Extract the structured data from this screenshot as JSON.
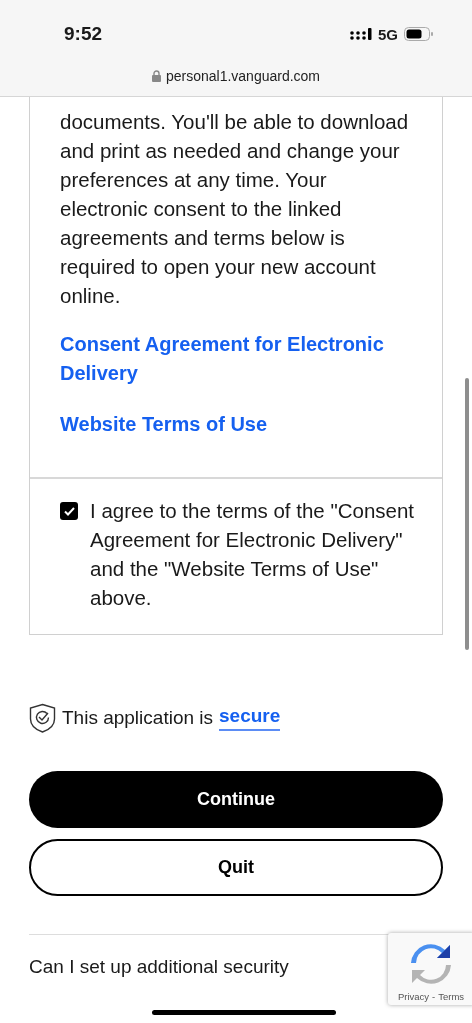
{
  "status_bar": {
    "time": "9:52",
    "network": "5G"
  },
  "address_bar": {
    "url": "personal1.vanguard.com"
  },
  "consent_card": {
    "paragraph": "documents. You'll be able to download and print as needed and change your preferences at any time. Your electronic consent to the linked agreements and terms below is required to open your new account online.",
    "links": [
      "Consent Agreement for Electronic Delivery",
      "Website Terms of Use"
    ],
    "agreement": {
      "checked": true,
      "label": "I agree to the terms of the \"Consent Agreement for Electronic Delivery\" and the \"Website Terms of Use\" above."
    }
  },
  "security_note": {
    "text": "This application is",
    "link": "secure"
  },
  "buttons": [
    {
      "label": "Continue",
      "kind": "primary"
    },
    {
      "label": "Quit",
      "kind": "secondary"
    }
  ],
  "faq": {
    "question": "Can I set up additional security"
  },
  "recaptcha": {
    "privacy": "Privacy",
    "separator": "-",
    "terms": "Terms"
  }
}
